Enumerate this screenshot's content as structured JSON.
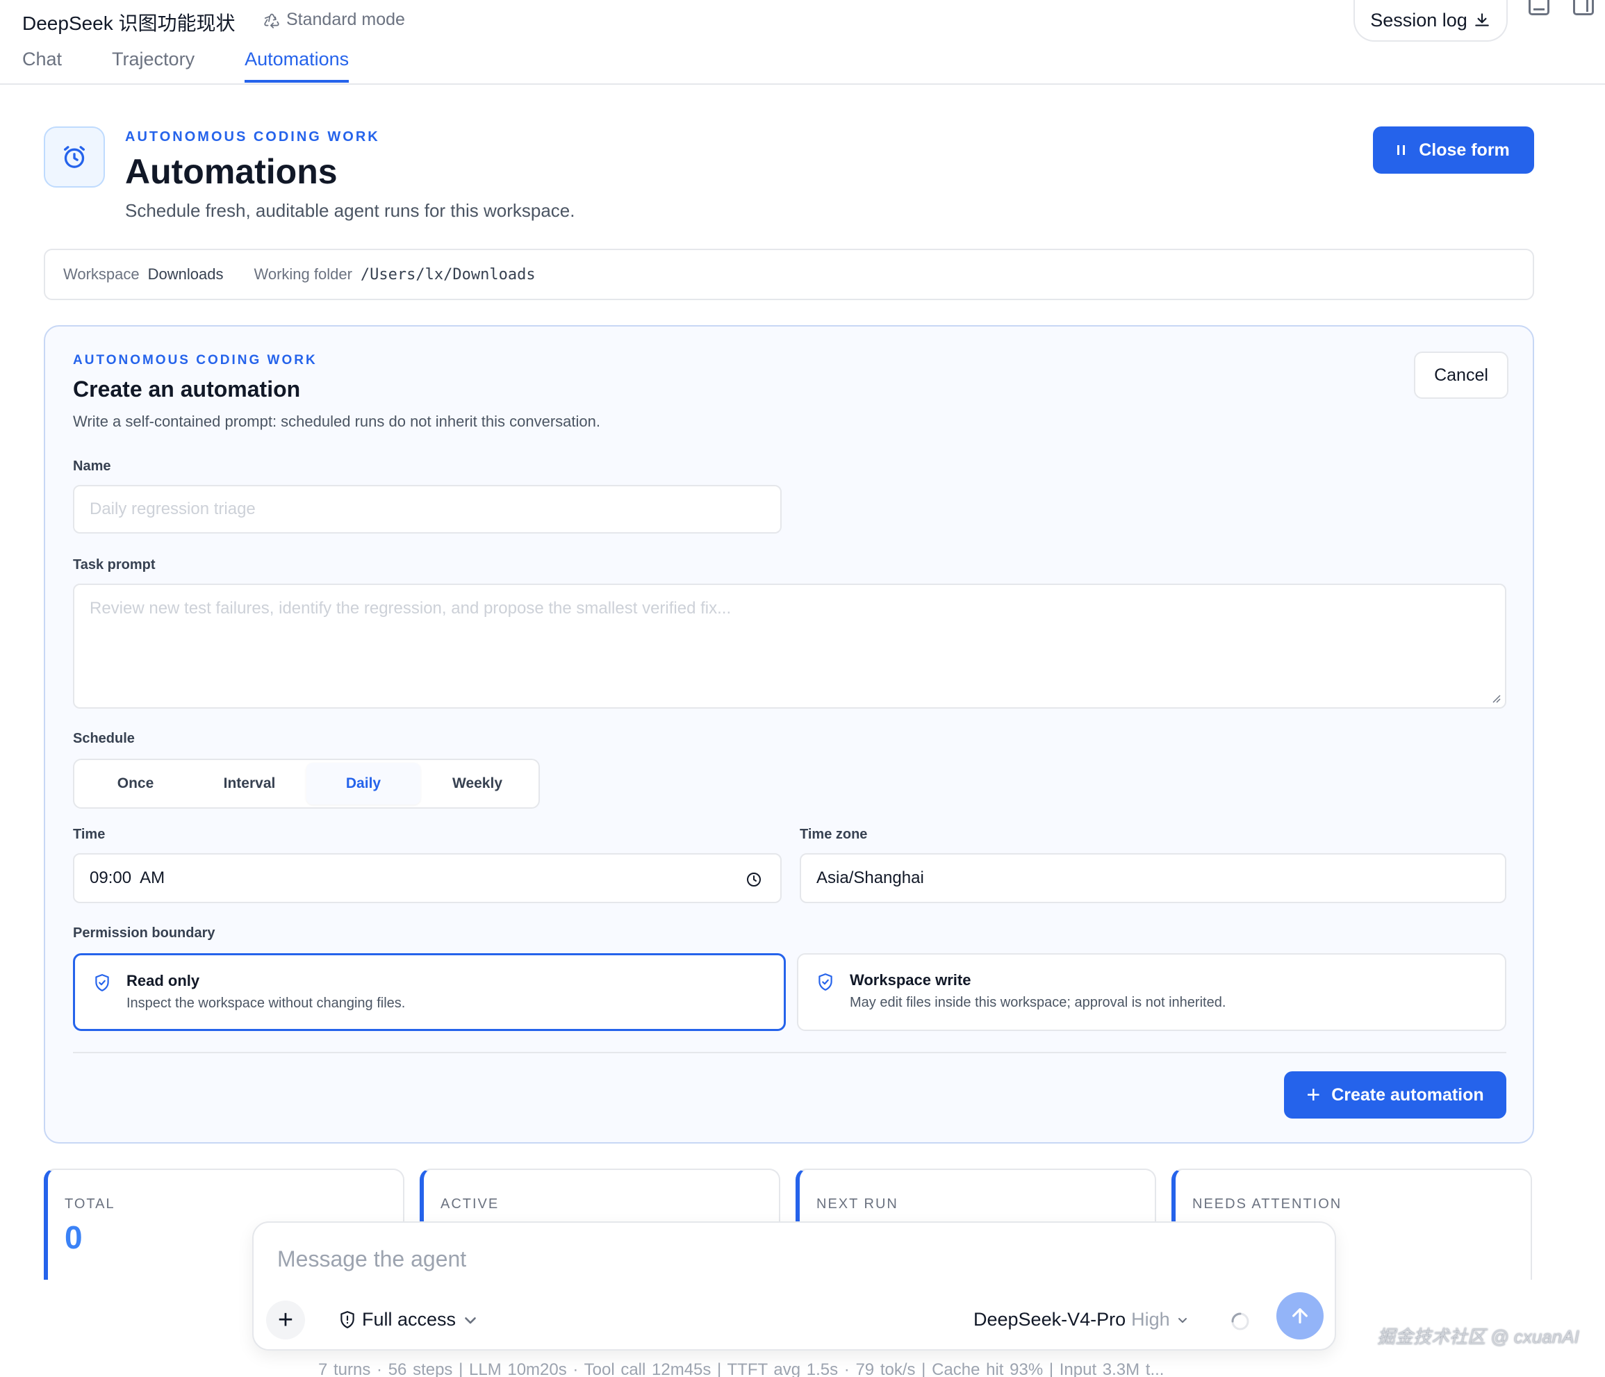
{
  "app": {
    "title": "DeepSeek 识图功能现状",
    "mode": "Standard mode",
    "session_log": "Session log"
  },
  "tabs": [
    {
      "label": "Chat"
    },
    {
      "label": "Trajectory"
    },
    {
      "label": "Automations",
      "active": true
    }
  ],
  "header": {
    "eyebrow": "AUTONOMOUS CODING WORK",
    "title": "Automations",
    "subtitle": "Schedule fresh, auditable agent runs for this workspace.",
    "close_form": "Close form",
    "icon": "clock-icon"
  },
  "workspace": {
    "workspace_label": "Workspace",
    "workspace_value": "Downloads",
    "folder_label": "Working folder",
    "folder_value": "/Users/lx/Downloads"
  },
  "form": {
    "eyebrow": "AUTONOMOUS CODING WORK",
    "title": "Create an automation",
    "subtitle": "Write a self-contained prompt: scheduled runs do not inherit this conversation.",
    "cancel": "Cancel",
    "name_label": "Name",
    "name_placeholder": "Daily regression triage",
    "prompt_label": "Task prompt",
    "prompt_placeholder": "Review new test failures, identify the regression, and propose the smallest verified fix...",
    "schedule_label": "Schedule",
    "schedule_options": [
      "Once",
      "Interval",
      "Daily",
      "Weekly"
    ],
    "schedule_selected": "Daily",
    "time_label": "Time",
    "time_value": "09:00  AM",
    "timezone_label": "Time zone",
    "timezone_value": "Asia/Shanghai",
    "permission_label": "Permission boundary",
    "permissions": [
      {
        "title": "Read only",
        "desc": "Inspect the workspace without changing files.",
        "selected": true
      },
      {
        "title": "Workspace write",
        "desc": "May edit files inside this workspace; approval is not inherited.",
        "selected": false
      }
    ],
    "create": "Create automation"
  },
  "stats": [
    {
      "label": "TOTAL",
      "value": "0"
    },
    {
      "label": "ACTIVE",
      "value": ""
    },
    {
      "label": "NEXT RUN",
      "value": ""
    },
    {
      "label": "NEEDS ATTENTION",
      "value": ""
    }
  ],
  "composer": {
    "placeholder": "Message the agent",
    "access": "Full access",
    "model": "DeepSeek-V4-Pro",
    "effort": "High"
  },
  "status_line": "7 turns · 56 steps   |   LLM 10m20s · Tool call 12m45s   |   TTFT avg 1.5s · 79 tok/s   |   Cache hit 93%   |   Input 3.3M t...",
  "watermark": "掘金技术社区 @ cxuanAI",
  "colors": {
    "accent": "#2563eb",
    "send_disabled": "#93b4f8",
    "card_border": "#c7d7f5"
  }
}
